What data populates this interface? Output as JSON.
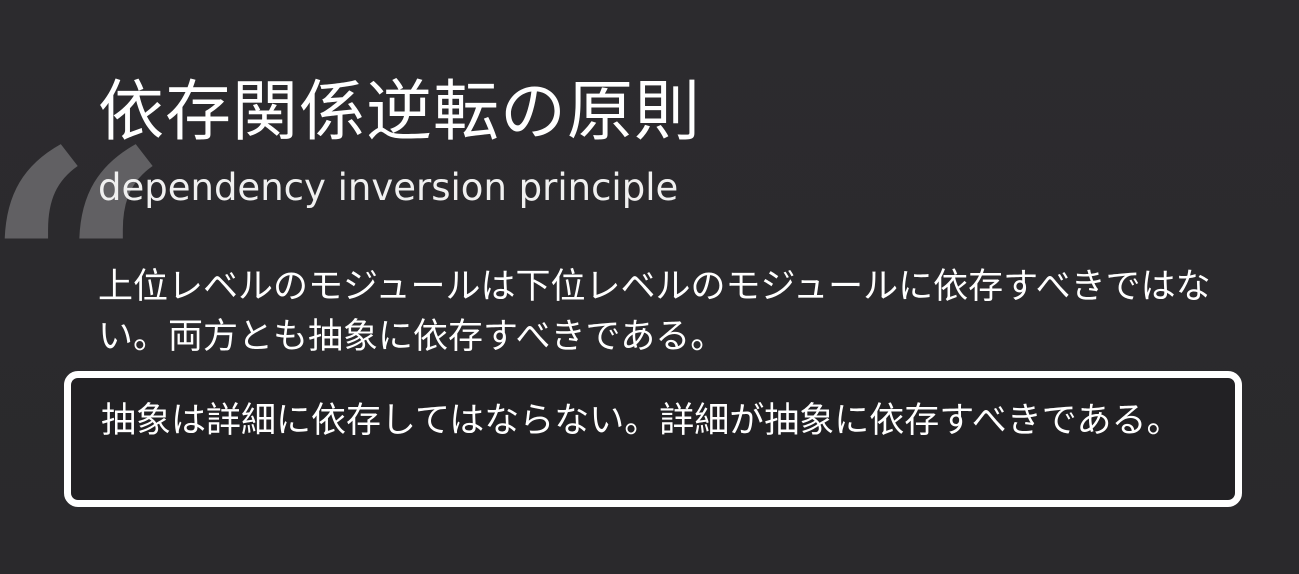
{
  "slide": {
    "title": "依存関係逆転の原則",
    "subtitle": "dependency inversion principle",
    "quote_mark": "“",
    "body": "上位レベルのモジュールは下位レベルのモジュールに依存すべきではない。両方とも抽象に依存すべきである。",
    "highlight": "抽象は詳細に依存してはならない。詳細が抽象に依存すべきである。"
  },
  "colors": {
    "background": "#2b2a2d",
    "text": "#ffffff",
    "quote_mark": "#616063",
    "highlight_border": "#ffffff"
  }
}
